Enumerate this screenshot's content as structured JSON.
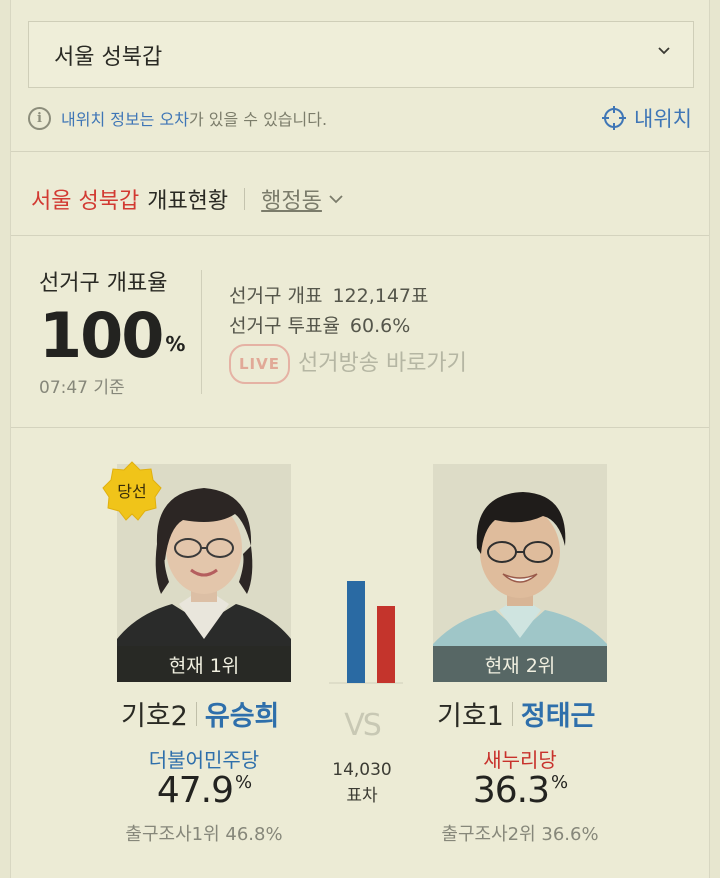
{
  "region_select": {
    "value": "서울 성북갑"
  },
  "notice": {
    "part1": "내위치 정보는 오차",
    "part2": "가 있을 수 있습니다."
  },
  "my_location": {
    "label": "내위치"
  },
  "title": {
    "region": "서울 성북갑",
    "status": "개표현황",
    "admin_link": "행정동"
  },
  "count": {
    "label": "선거구 개표율",
    "percent": "100",
    "percent_unit": "%",
    "time": "07:47 기준",
    "votes_label": "선거구 개표",
    "votes_value": "122,147표",
    "turnout_label": "선거구 투표율",
    "turnout_value": "60.6%",
    "live_badge": "LIVE",
    "live_link": "선거방송 바로가기"
  },
  "candidates": [
    {
      "rank_text": "현재 1위",
      "number": "기호2",
      "name": "유승희",
      "party": "더불어민주당",
      "party_color": "#2e6fab",
      "percent": "47.9",
      "percent_unit": "%",
      "exit_poll": "출구조사1위 46.8%",
      "vote_share": 47.9,
      "bar_color": "#2a6aa3",
      "winner_badge": "당선"
    },
    {
      "rank_text": "현재 2위",
      "number": "기호1",
      "name": "정태근",
      "party": "새누리당",
      "party_color": "#c8322c",
      "percent": "36.3",
      "percent_unit": "%",
      "exit_poll": "출구조사2위 36.6%",
      "vote_share": 36.3,
      "bar_color": "#c4342c"
    }
  ],
  "vs": {
    "label": "VS",
    "gap_value": "14,030",
    "gap_label": "표차"
  },
  "colors": {
    "accent_blue": "#3f76b6",
    "accent_red": "#d23a32",
    "background": "#ecebd5"
  }
}
